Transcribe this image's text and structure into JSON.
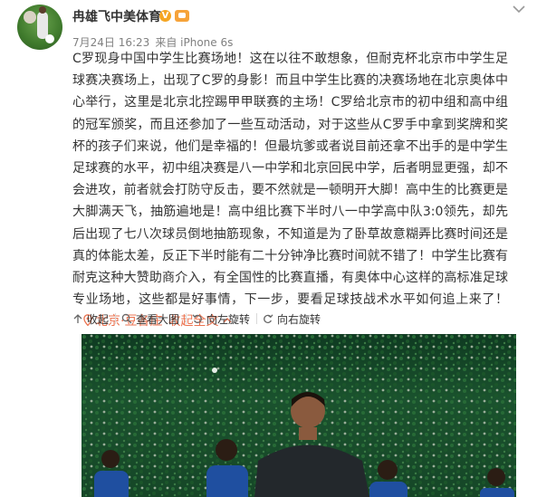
{
  "user": {
    "name": "冉雄飞中美体育"
  },
  "meta": {
    "date": "7月24日 16:23",
    "source_prefix": "来自",
    "source": "iPhone 6s"
  },
  "post": {
    "text": "C罗现身中国中学生比赛场地！这在以往不敢想象，但耐克杯北京市中学生足球赛决赛场上，出现了C罗的身影！而且中学生比赛的决赛场地在北京奥体中心举行，这里是北京北控踢甲甲联赛的主场！C罗给北京市的初中组和高中组的冠军颁奖，而且还参加了一些互动活动，对于这些从C罗手中拿到奖牌和奖杯的孩子们来说，他们是幸福的！但最坑爹或者说目前还拿不出手的是中学生足球赛的水平，初中组决赛是八一中学和北京回民中学，后者明显更强，却不会进攻，前者就会打防守反击，要不然就是一顿明开大脚！高中生的比赛更是大脚满天飞，抽筋遍地是！高中组比赛下半时八一中学高中队3:0领先，却先后出现了七八次球员倒地抽筋现象，不知道是为了卧草故意糊弄比赛时间还是真的体能太差，反正下半时能有二十分钟净比赛时间就不错了！中学生比赛有耐克这种大赞助商介入，有全国性的比赛直播，有奥体中心这样的高标准足球专业场地，这些都是好事情，下一步，要看足球技战术水平如何追上来了！",
    "location": "北京·豆各庄",
    "collapse_label": "收起全文"
  },
  "toolbar": {
    "collapse": "收起",
    "view_large": "查看大图",
    "rotate_left": "向左旋转",
    "rotate_right": "向右旋转"
  },
  "colors": {
    "accent": "#eb7350",
    "verified_badge": "#f5a623"
  },
  "icons": {
    "verified": "verified-v-icon",
    "level": "level-badge-icon",
    "dropdown": "chevron-down-icon",
    "location": "location-pin-icon",
    "collapse_up": "chevron-up-icon",
    "toolbar_collapse": "arrow-up-icon",
    "toolbar_view": "magnifier-icon",
    "toolbar_rotate_left": "rotate-left-icon",
    "toolbar_rotate_right": "rotate-right-icon"
  }
}
